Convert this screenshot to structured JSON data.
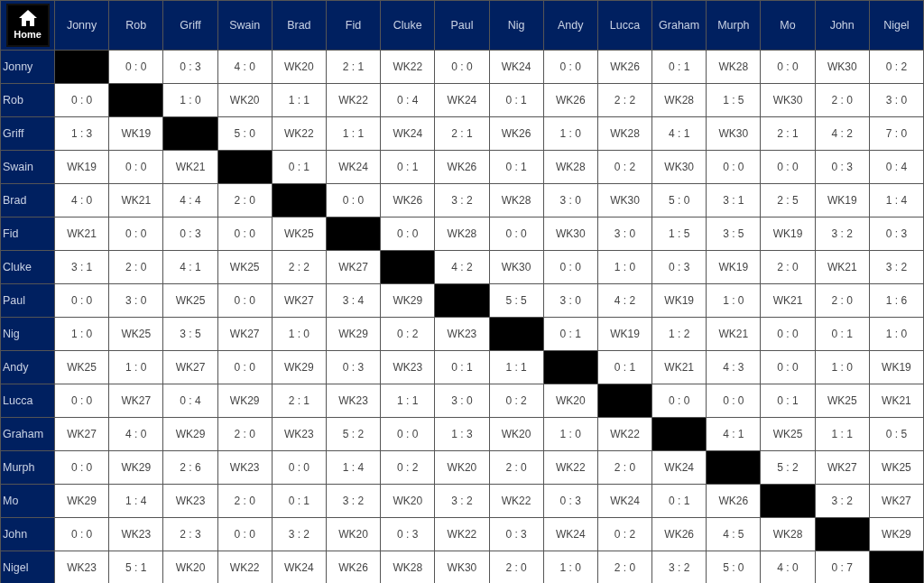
{
  "home_button": {
    "label": "Home"
  },
  "columns": [
    "Jonny",
    "Rob",
    "Griff",
    "Swain",
    "Brad",
    "Fid",
    "Cluke",
    "Paul",
    "Nig",
    "Andy",
    "Lucca",
    "Graham",
    "Murph",
    "Mo",
    "John",
    "Nigel"
  ],
  "rows": [
    {
      "name": "Jonny",
      "cells": [
        null,
        "0 : 0",
        "0 : 3",
        "4 : 0",
        "WK20",
        "2 : 1",
        "WK22",
        "0 : 0",
        "WK24",
        "0 : 0",
        "WK26",
        "0 : 1",
        "WK28",
        "0 : 0",
        "WK30",
        "0 : 2"
      ]
    },
    {
      "name": "Rob",
      "cells": [
        "0 : 0",
        null,
        "1 : 0",
        "WK20",
        "1 : 1",
        "WK22",
        "0 : 4",
        "WK24",
        "0 : 1",
        "WK26",
        "2 : 2",
        "WK28",
        "1 : 5",
        "WK30",
        "2 : 0",
        "3 : 0"
      ]
    },
    {
      "name": "Griff",
      "cells": [
        "1 : 3",
        "WK19",
        null,
        "5 : 0",
        "WK22",
        "1 : 1",
        "WK24",
        "2 : 1",
        "WK26",
        "1 : 0",
        "WK28",
        "4 : 1",
        "WK30",
        "2 : 1",
        "4 : 2",
        "7 : 0"
      ]
    },
    {
      "name": "Swain",
      "cells": [
        "WK19",
        "0 : 0",
        "WK21",
        null,
        "0 : 1",
        "WK24",
        "0 : 1",
        "WK26",
        "0 : 1",
        "WK28",
        "0 : 2",
        "WK30",
        "0 : 0",
        "0 : 0",
        "0 : 3",
        "0 : 4"
      ]
    },
    {
      "name": "Brad",
      "cells": [
        "4 : 0",
        "WK21",
        "4 : 4",
        "2 : 0",
        null,
        "0 : 0",
        "WK26",
        "3 : 2",
        "WK28",
        "3 : 0",
        "WK30",
        "5 : 0",
        "3 : 1",
        "2 : 5",
        "WK19",
        "1 : 4"
      ]
    },
    {
      "name": "Fid",
      "cells": [
        "WK21",
        "0 : 0",
        "0 : 3",
        "0 : 0",
        "WK25",
        null,
        "0 : 0",
        "WK28",
        "0 : 0",
        "WK30",
        "3 : 0",
        "1 : 5",
        "3 : 5",
        "WK19",
        "3 : 2",
        "0 : 3"
      ]
    },
    {
      "name": "Cluke",
      "cells": [
        "3 : 1",
        "2 : 0",
        "4 : 1",
        "WK25",
        "2 : 2",
        "WK27",
        null,
        "4 : 2",
        "WK30",
        "0 : 0",
        "1 : 0",
        "0 : 3",
        "WK19",
        "2 : 0",
        "WK21",
        "3 : 2"
      ]
    },
    {
      "name": "Paul",
      "cells": [
        "0 : 0",
        "3 : 0",
        "WK25",
        "0 : 0",
        "WK27",
        "3 : 4",
        "WK29",
        null,
        "5 : 5",
        "3 : 0",
        "4 : 2",
        "WK19",
        "1 : 0",
        "WK21",
        "2 : 0",
        "1 : 6"
      ]
    },
    {
      "name": "Nig",
      "cells": [
        "1 : 0",
        "WK25",
        "3 : 5",
        "WK27",
        "1 : 0",
        "WK29",
        "0 : 2",
        "WK23",
        null,
        "0 : 1",
        "WK19",
        "1 : 2",
        "WK21",
        "0 : 0",
        "0 : 1",
        "1 : 0"
      ]
    },
    {
      "name": "Andy",
      "cells": [
        "WK25",
        "1 : 0",
        "WK27",
        "0 : 0",
        "WK29",
        "0 : 3",
        "WK23",
        "0 : 1",
        "1 : 1",
        null,
        "0 : 1",
        "WK21",
        "4 : 3",
        "0 : 0",
        "1 : 0",
        "WK19"
      ]
    },
    {
      "name": "Lucca",
      "cells": [
        "0 : 0",
        "WK27",
        "0 : 4",
        "WK29",
        "2 : 1",
        "WK23",
        "1 : 1",
        "3 : 0",
        "0 : 2",
        "WK20",
        null,
        "0 : 0",
        "0 : 0",
        "0 : 1",
        "WK25",
        "WK21"
      ]
    },
    {
      "name": "Graham",
      "cells": [
        "WK27",
        "4 : 0",
        "WK29",
        "2 : 0",
        "WK23",
        "5 : 2",
        "0 : 0",
        "1 : 3",
        "WK20",
        "1 : 0",
        "WK22",
        null,
        "4 : 1",
        "WK25",
        "1 : 1",
        "0 : 5"
      ]
    },
    {
      "name": "Murph",
      "cells": [
        "0 : 0",
        "WK29",
        "2 : 6",
        "WK23",
        "0 : 0",
        "1 : 4",
        "0 : 2",
        "WK20",
        "2 : 0",
        "WK22",
        "2 : 0",
        "WK24",
        null,
        "5 : 2",
        "WK27",
        "WK25"
      ]
    },
    {
      "name": "Mo",
      "cells": [
        "WK29",
        "1 : 4",
        "WK23",
        "2 : 0",
        "0 : 1",
        "3 : 2",
        "WK20",
        "3 : 2",
        "WK22",
        "0 : 3",
        "WK24",
        "0 : 1",
        "WK26",
        null,
        "3 : 2",
        "WK27"
      ]
    },
    {
      "name": "John",
      "cells": [
        "0 : 0",
        "WK23",
        "2 : 3",
        "0 : 0",
        "3 : 2",
        "WK20",
        "0 : 3",
        "WK22",
        "0 : 3",
        "WK24",
        "0 : 2",
        "WK26",
        "4 : 5",
        "WK28",
        null,
        "WK29"
      ]
    },
    {
      "name": "Nigel",
      "cells": [
        "WK23",
        "5 : 1",
        "WK20",
        "WK22",
        "WK24",
        "WK26",
        "WK28",
        "WK30",
        "2 : 0",
        "1 : 0",
        "2 : 0",
        "3 : 2",
        "5 : 0",
        "4 : 0",
        "0 : 7",
        null
      ]
    }
  ]
}
